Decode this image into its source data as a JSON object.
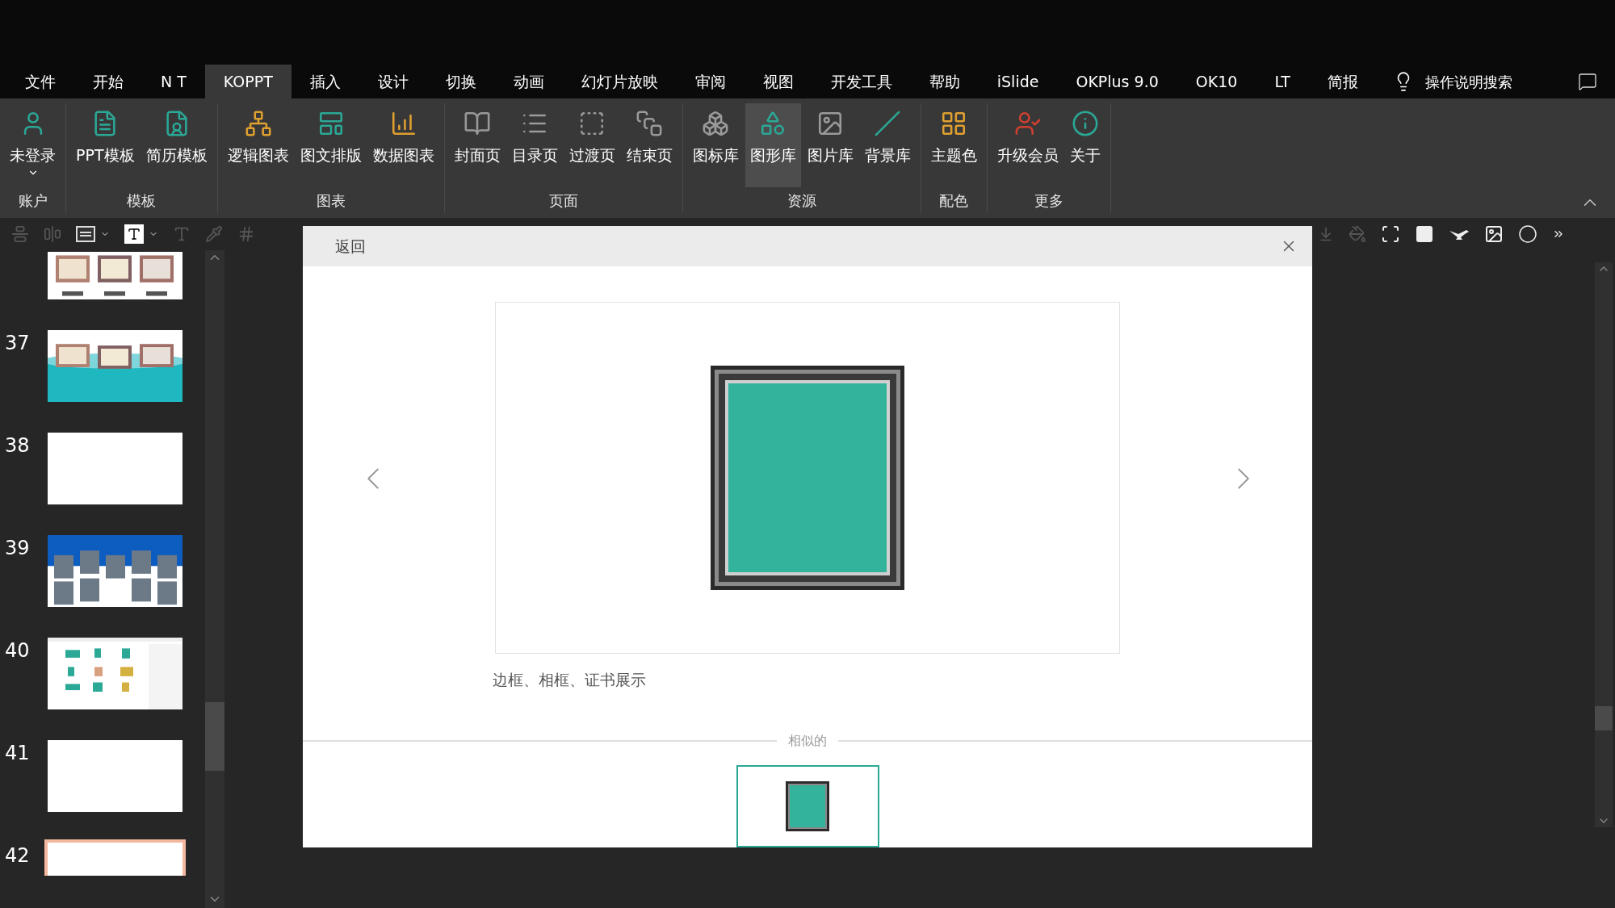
{
  "menu_tabs": [
    {
      "label": "文件",
      "selected": false
    },
    {
      "label": "开始",
      "selected": false
    },
    {
      "label": "N T",
      "selected": false
    },
    {
      "label": "KOPPT",
      "selected": true
    },
    {
      "label": "插入",
      "selected": false
    },
    {
      "label": "设计",
      "selected": false
    },
    {
      "label": "切换",
      "selected": false
    },
    {
      "label": "动画",
      "selected": false
    },
    {
      "label": "幻灯片放映",
      "selected": false
    },
    {
      "label": "审阅",
      "selected": false
    },
    {
      "label": "视图",
      "selected": false
    },
    {
      "label": "开发工具",
      "selected": false
    },
    {
      "label": "帮助",
      "selected": false
    },
    {
      "label": "iSlide",
      "selected": false
    },
    {
      "label": "OKPlus 9.0",
      "selected": false
    },
    {
      "label": "OK10",
      "selected": false
    },
    {
      "label": "LT",
      "selected": false
    },
    {
      "label": "简报",
      "selected": false
    }
  ],
  "search": {
    "label": "操作说明搜索"
  },
  "ribbon_groups": [
    {
      "label": "账户",
      "buttons": [
        {
          "label": "未登录",
          "selected": false
        }
      ]
    },
    {
      "label": "模板",
      "buttons": [
        {
          "label": "PPT模板",
          "selected": false
        },
        {
          "label": "简历模板",
          "selected": false
        }
      ]
    },
    {
      "label": "图表",
      "buttons": [
        {
          "label": "逻辑图表",
          "selected": false
        },
        {
          "label": "图文排版",
          "selected": false
        },
        {
          "label": "数据图表",
          "selected": false
        }
      ]
    },
    {
      "label": "页面",
      "buttons": [
        {
          "label": "封面页",
          "selected": false
        },
        {
          "label": "目录页",
          "selected": false
        },
        {
          "label": "过渡页",
          "selected": false
        },
        {
          "label": "结束页",
          "selected": false
        }
      ]
    },
    {
      "label": "资源",
      "buttons": [
        {
          "label": "图标库",
          "selected": false
        },
        {
          "label": "图形库",
          "selected": true
        },
        {
          "label": "图片库",
          "selected": false
        },
        {
          "label": "背景库",
          "selected": false
        }
      ]
    },
    {
      "label": "配色",
      "buttons": [
        {
          "label": "主题色",
          "selected": false
        }
      ]
    },
    {
      "label": "更多",
      "buttons": [
        {
          "label": "升级会员",
          "selected": false
        },
        {
          "label": "关于",
          "selected": false
        }
      ]
    }
  ],
  "slides": [
    {
      "kind": "picture",
      "selected": false
    },
    {
      "number": "37",
      "kind": "picture",
      "selected": false
    },
    {
      "number": "38",
      "kind": "blank",
      "selected": false
    },
    {
      "number": "39",
      "kind": "picture",
      "selected": false
    },
    {
      "number": "40",
      "kind": "picture",
      "selected": false
    },
    {
      "number": "41",
      "kind": "blank",
      "selected": false
    },
    {
      "number": "42",
      "kind": "blank",
      "selected": true
    }
  ],
  "dialog": {
    "back": "返回",
    "caption": "边框、相框、证书展示",
    "similar_label": "相似的",
    "similar": [
      {
        "selected": true
      }
    ]
  }
}
